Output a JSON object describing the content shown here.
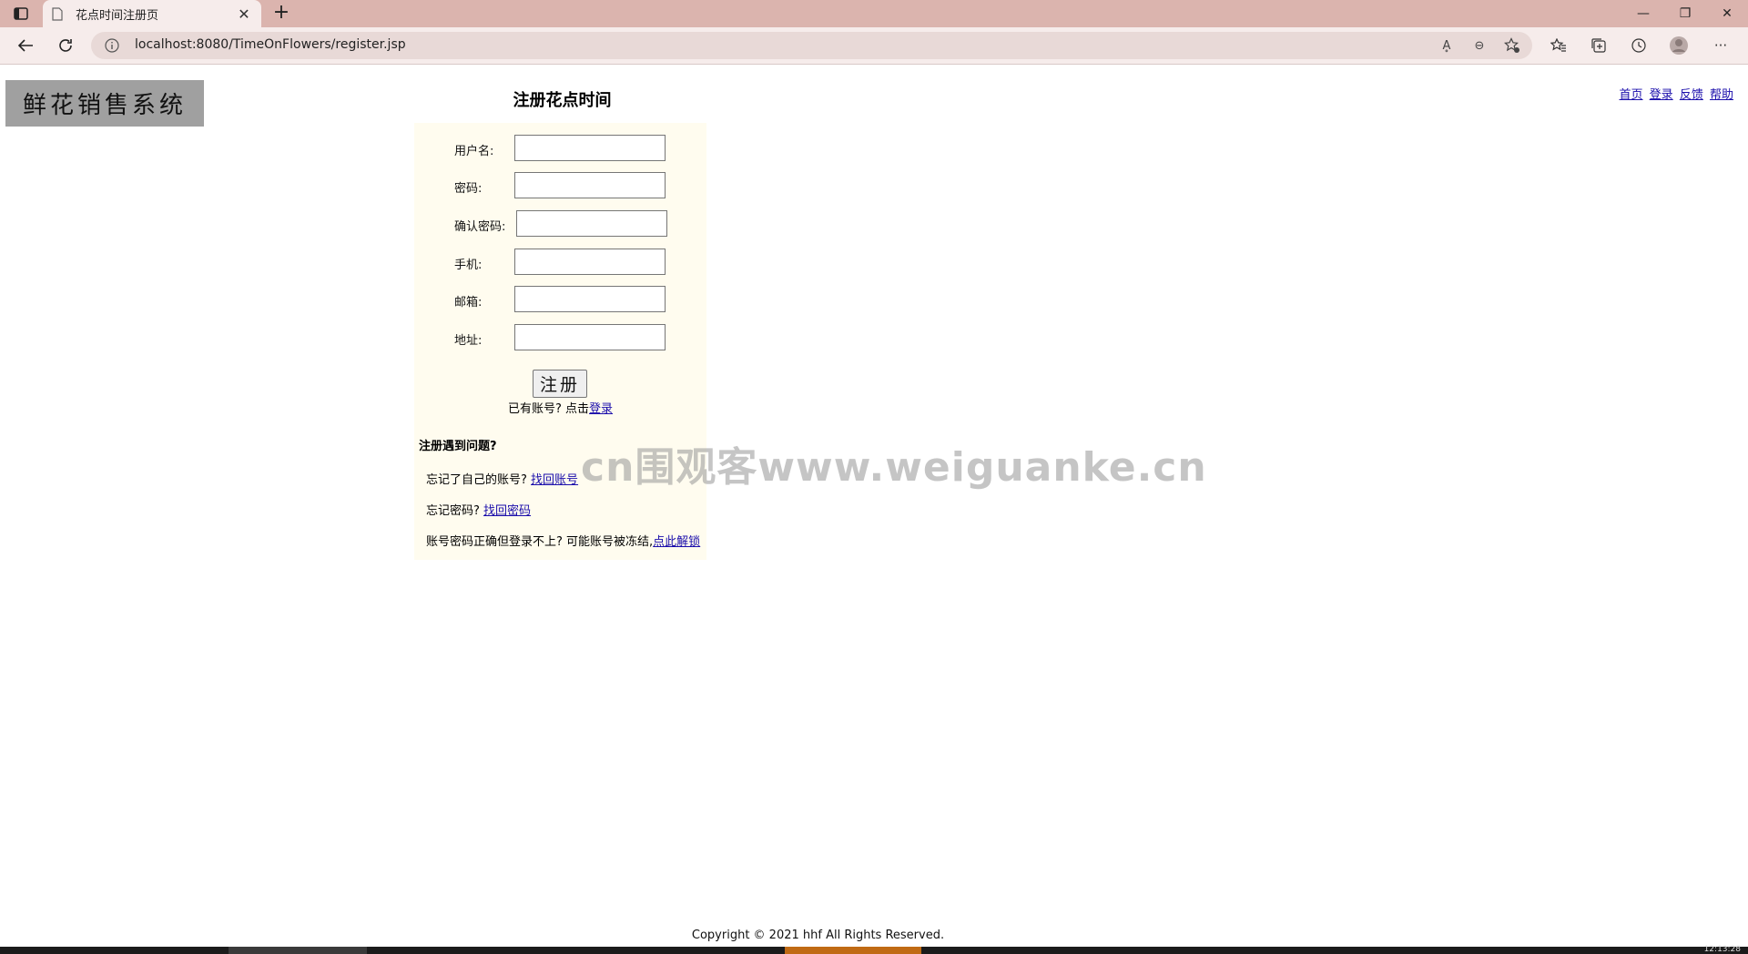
{
  "browser": {
    "tab_title": "花点时间注册页",
    "url": "localhost:8080/TimeOnFlowers/register.jsp",
    "tab_close": "✕",
    "new_tab": "+",
    "minimize": "—",
    "restore": "❐",
    "close": "✕",
    "read_aloud": "Ḁ",
    "zoom_out": "⊖",
    "more": "···"
  },
  "site": {
    "logo_text": "鲜花销售系统",
    "heading": "注册花点时间",
    "nav_links": [
      "首页",
      "登录",
      "反馈",
      "帮助"
    ]
  },
  "form": {
    "fields": [
      {
        "label": "用户名:",
        "value": ""
      },
      {
        "label": "密码:",
        "value": ""
      },
      {
        "label": "确认密码:",
        "value": ""
      },
      {
        "label": "手机:",
        "value": ""
      },
      {
        "label": "邮箱:",
        "value": ""
      },
      {
        "label": "地址:",
        "value": ""
      }
    ],
    "submit_label": "注册",
    "login_hint_prefix": "已有账号? 点击",
    "login_link": "登录"
  },
  "help": {
    "title": "注册遇到问题?",
    "items": [
      {
        "text": "忘记了自己的账号?",
        "link": "找回账号"
      },
      {
        "text": "忘记密码?",
        "link": "找回密码"
      },
      {
        "text": "账号密码正确但登录不上? 可能账号被冻结,",
        "link": "点此解锁"
      }
    ]
  },
  "watermark": "cn围观客www.weiguanke.cn",
  "footer": {
    "copyright": "Copyright © 2021 hhf All Rights Reserved."
  },
  "taskbar": {
    "clock": "12:13:28"
  }
}
